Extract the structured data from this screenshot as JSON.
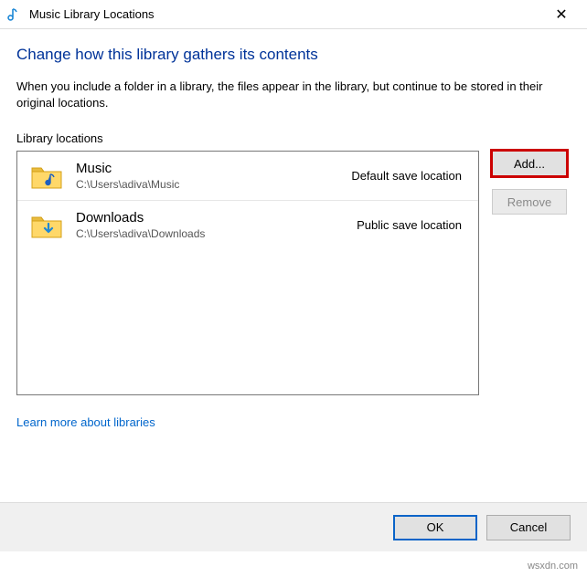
{
  "titlebar": {
    "title": "Music Library Locations",
    "close_glyph": "✕"
  },
  "heading": "Change how this library gathers its contents",
  "description": "When you include a folder in a library, the files appear in the library, but continue to be stored in their original locations.",
  "section_label": "Library locations",
  "locations": [
    {
      "name": "Music",
      "path": "C:\\Users\\adiva\\Music",
      "tag": "Default save location",
      "icon": "music-folder-icon"
    },
    {
      "name": "Downloads",
      "path": "C:\\Users\\adiva\\Downloads",
      "tag": "Public save location",
      "icon": "downloads-folder-icon"
    }
  ],
  "buttons": {
    "add": "Add...",
    "remove": "Remove",
    "ok": "OK",
    "cancel": "Cancel"
  },
  "link": "Learn more about libraries",
  "watermark": "wsxdn.com"
}
